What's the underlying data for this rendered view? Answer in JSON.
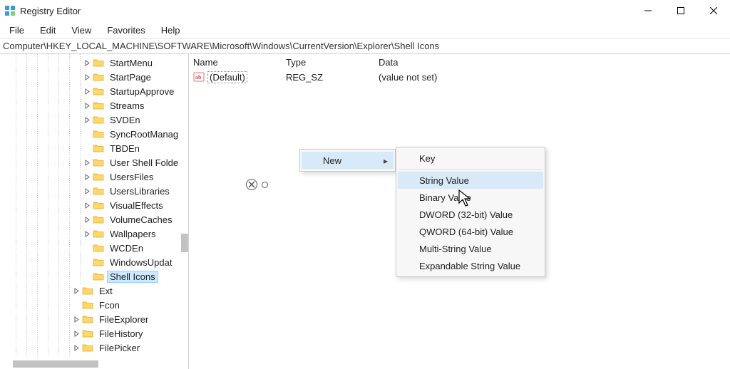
{
  "title": "Registry Editor",
  "menubar": [
    "File",
    "Edit",
    "View",
    "Favorites",
    "Help"
  ],
  "address": "Computer\\HKEY_LOCAL_MACHINE\\SOFTWARE\\Microsoft\\Windows\\CurrentVersion\\Explorer\\Shell Icons",
  "tree": [
    {
      "label": "StartMenu",
      "depth": 7,
      "expandable": true
    },
    {
      "label": "StartPage",
      "depth": 7,
      "expandable": true
    },
    {
      "label": "StartupApprove",
      "depth": 7,
      "expandable": true
    },
    {
      "label": "Streams",
      "depth": 7,
      "expandable": true
    },
    {
      "label": "SVDEn",
      "depth": 7,
      "expandable": true
    },
    {
      "label": "SyncRootManag",
      "depth": 7,
      "expandable": false
    },
    {
      "label": "TBDEn",
      "depth": 7,
      "expandable": false
    },
    {
      "label": "User Shell Folde",
      "depth": 7,
      "expandable": true
    },
    {
      "label": "UsersFiles",
      "depth": 7,
      "expandable": true
    },
    {
      "label": "UsersLibraries",
      "depth": 7,
      "expandable": true
    },
    {
      "label": "VisualEffects",
      "depth": 7,
      "expandable": true
    },
    {
      "label": "VolumeCaches",
      "depth": 7,
      "expandable": true
    },
    {
      "label": "Wallpapers",
      "depth": 7,
      "expandable": true
    },
    {
      "label": "WCDEn",
      "depth": 7,
      "expandable": false
    },
    {
      "label": "WindowsUpdat",
      "depth": 7,
      "expandable": false
    },
    {
      "label": "Shell Icons",
      "depth": 7,
      "expandable": false,
      "selected": true
    },
    {
      "label": "Ext",
      "depth": 6,
      "expandable": true
    },
    {
      "label": "Fcon",
      "depth": 6,
      "expandable": false
    },
    {
      "label": "FileExplorer",
      "depth": 6,
      "expandable": true
    },
    {
      "label": "FileHistory",
      "depth": 6,
      "expandable": true
    },
    {
      "label": "FilePicker",
      "depth": 6,
      "expandable": true
    }
  ],
  "columns": {
    "name": "Name",
    "type": "Type",
    "data": "Data"
  },
  "values": [
    {
      "name": "(Default)",
      "type": "REG_SZ",
      "data": "(value not set)",
      "focused": true
    }
  ],
  "context_menu": {
    "parent": {
      "label": "New"
    },
    "submenu": [
      {
        "label": "Key"
      },
      {
        "label": "String Value",
        "hover": true
      },
      {
        "label": "Binary Value"
      },
      {
        "label": "DWORD (32-bit) Value"
      },
      {
        "label": "QWORD (64-bit) Value"
      },
      {
        "label": "Multi-String Value"
      },
      {
        "label": "Expandable String Value"
      }
    ]
  }
}
